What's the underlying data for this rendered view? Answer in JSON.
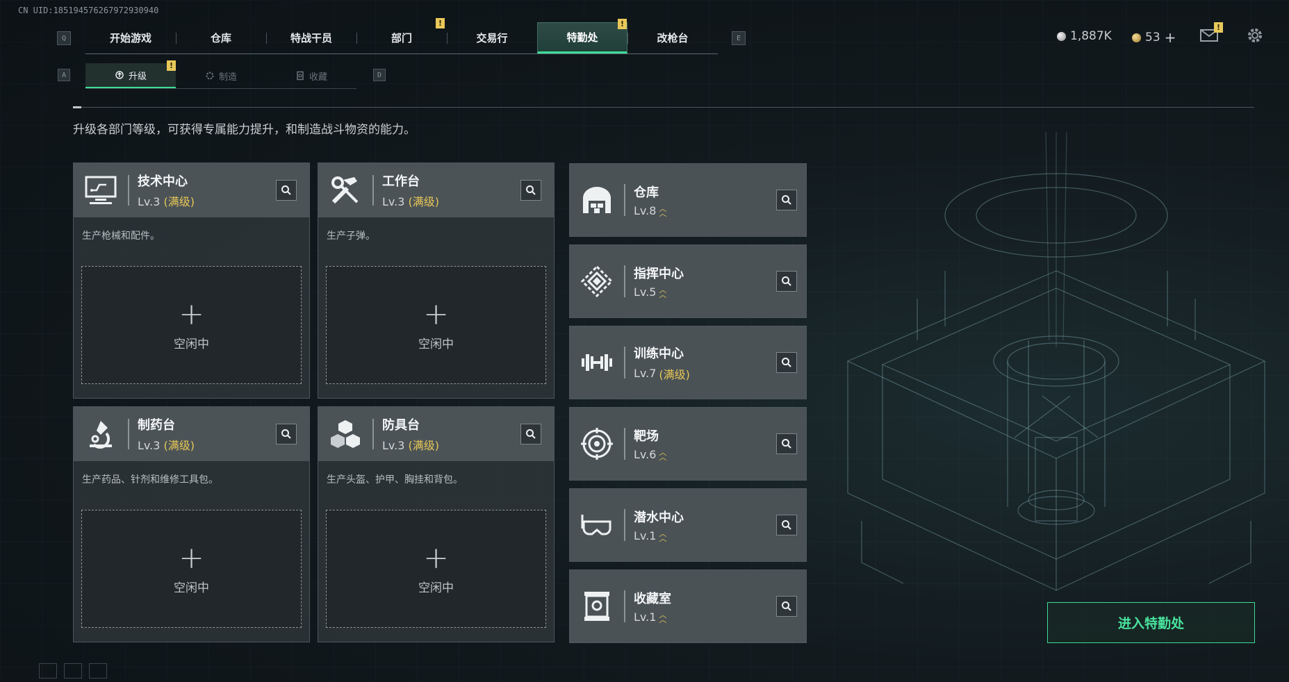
{
  "uid": "CN UID:18519457626797293094​0",
  "top_nav": {
    "left_key": "Q",
    "right_key": "E",
    "tabs": [
      {
        "label": "开始游戏",
        "active": false,
        "badge": ""
      },
      {
        "label": "仓库",
        "active": false,
        "badge": ""
      },
      {
        "label": "特战干员",
        "active": false,
        "badge": ""
      },
      {
        "label": "部门",
        "active": false,
        "badge": "!"
      },
      {
        "label": "交易行",
        "active": false,
        "badge": ""
      },
      {
        "label": "特勤处",
        "active": true,
        "badge": "!"
      },
      {
        "label": "改枪台",
        "active": false,
        "badge": ""
      }
    ]
  },
  "currencies": {
    "silver": "1,887K",
    "gold": "53",
    "gold_add": "+",
    "mail_badge": "!"
  },
  "sub_nav": {
    "left_key": "A",
    "right_key": "D",
    "tabs": [
      {
        "label": "升级",
        "active": true,
        "badge": "!"
      },
      {
        "label": "制造",
        "active": false
      },
      {
        "label": "收藏",
        "active": false
      }
    ]
  },
  "description": "升级各部门等级，可获得专属能力提升，和制造战斗物资的能力。",
  "craft_cards": [
    {
      "name": "技术中心",
      "lv": "Lv.3",
      "full": "(满级)",
      "desc": "生产枪械和配件。",
      "slot_plus": "+",
      "slot_status": "空闲中",
      "icon": "computer-icon"
    },
    {
      "name": "工作台",
      "lv": "Lv.3",
      "full": "(满级)",
      "desc": "生产子弹。",
      "slot_plus": "+",
      "slot_status": "空闲中",
      "icon": "tools-icon"
    },
    {
      "name": "制药台",
      "lv": "Lv.3",
      "full": "(满级)",
      "desc": "生产药品、针剂和维修工具包。",
      "slot_plus": "+",
      "slot_status": "空闲中",
      "icon": "microscope-icon"
    },
    {
      "name": "防具台",
      "lv": "Lv.3",
      "full": "(满级)",
      "desc": "生产头盔、护甲、胸挂和背包。",
      "slot_plus": "+",
      "slot_status": "空闲中",
      "icon": "boxes-icon"
    }
  ],
  "facilities": [
    {
      "name": "仓库",
      "lv": "Lv.8",
      "full": "",
      "upgradable": true,
      "icon": "warehouse-icon"
    },
    {
      "name": "指挥中心",
      "lv": "Lv.5",
      "full": "",
      "upgradable": true,
      "icon": "command-icon"
    },
    {
      "name": "训练中心",
      "lv": "Lv.7",
      "full": "(满级)",
      "upgradable": false,
      "icon": "dumbbell-icon"
    },
    {
      "name": "靶场",
      "lv": "Lv.6",
      "full": "",
      "upgradable": true,
      "icon": "target-icon"
    },
    {
      "name": "潜水中心",
      "lv": "Lv.1",
      "full": "",
      "upgradable": true,
      "icon": "goggles-icon"
    },
    {
      "name": "收藏室",
      "lv": "Lv.1",
      "full": "",
      "upgradable": true,
      "icon": "display-case-icon"
    }
  ],
  "enter_button": "进入特勤处",
  "colors": {
    "accent": "#3ddc97",
    "full_level": "#e7c757",
    "badge": "#e8c85a"
  }
}
